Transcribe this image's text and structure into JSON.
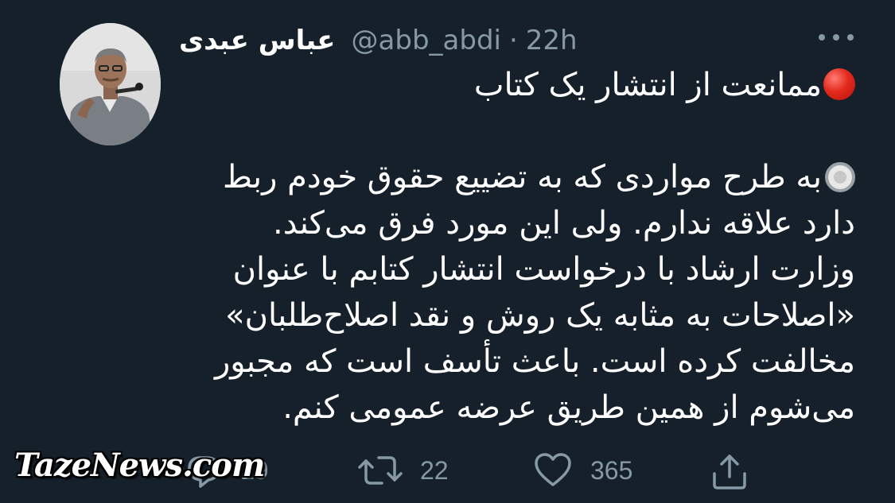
{
  "author": {
    "display_name": "عباس عبدی",
    "handle": "@abb_abdi",
    "separator": "·",
    "time": "22h"
  },
  "tweet": {
    "title_line": "ممانعت از انتشار یک کتاب",
    "body_lines": [
      "به طرح مواردی که به تضییع حقوق خودم ربط",
      "دارد علاقه ندارم. ولی این مورد فرق می‌کند.",
      "وزارت ارشاد با درخواست انتشار کتابم با عنوان",
      "«اصلاحات به مثابه یک روش و نقد اصلاح‌طلبان»",
      "مخالفت کرده است. باعث تأسف است که مجبور",
      "می‌شوم از همین طریق عرضه عمومی کنم."
    ]
  },
  "actions": {
    "replies": "19",
    "retweets": "22",
    "likes": "365"
  },
  "watermark": "TazeNews.com",
  "icons": {
    "title_emoji": "red-circle-icon",
    "bullet_emoji": "radio-button-icon",
    "more": "more-horizontal-icon",
    "reply": "reply-icon",
    "retweet": "retweet-icon",
    "like": "heart-icon",
    "share": "share-icon"
  },
  "colors": {
    "background": "#15202b",
    "text": "#ffffff",
    "secondary": "#8899a6"
  }
}
